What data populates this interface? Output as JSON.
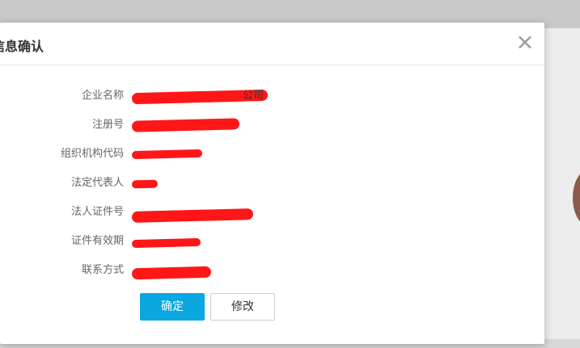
{
  "dialog": {
    "title": "信息确认",
    "close_symbol": "×",
    "fields": [
      {
        "label": "企业名称",
        "value": "公司"
      },
      {
        "label": "注册号",
        "value": ""
      },
      {
        "label": "组织机构代码",
        "value": ""
      },
      {
        "label": "法定代表人",
        "value": ""
      },
      {
        "label": "法人证件号",
        "value": ""
      },
      {
        "label": "证件有效期",
        "value": ""
      },
      {
        "label": "联系方式",
        "value": ""
      }
    ],
    "buttons": {
      "confirm": "确定",
      "edit": "修改"
    }
  },
  "colors": {
    "primary": "#0aa7e0",
    "redaction": "#ff1717"
  },
  "icons": {
    "close": "close-icon"
  }
}
